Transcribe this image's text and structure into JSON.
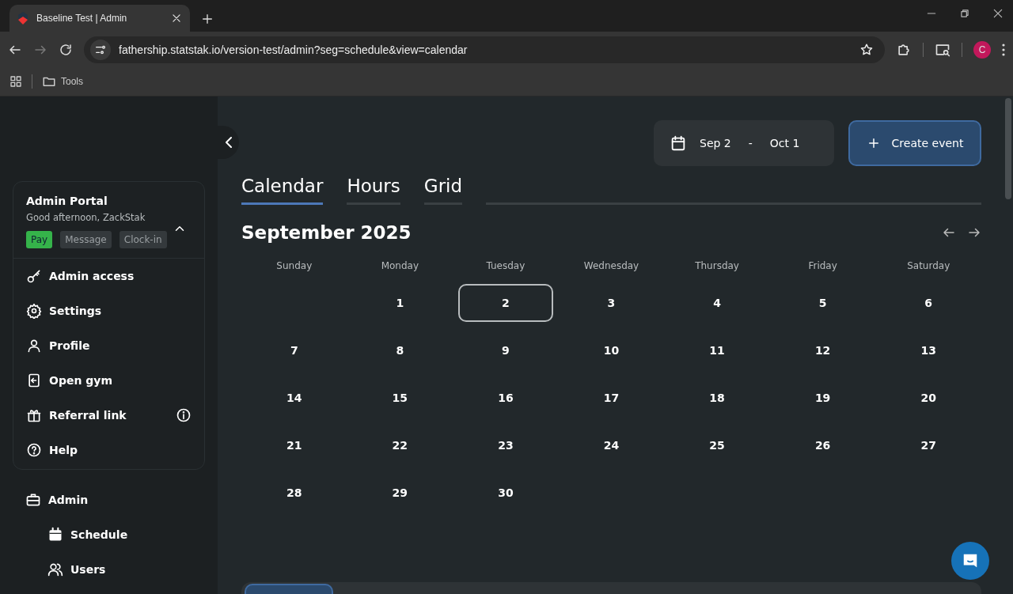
{
  "browser": {
    "tab_title": "Baseline Test | Admin",
    "url": "fathership.statstak.io/version-test/admin?seg=schedule&view=calendar",
    "bookmarks": [
      "Tools"
    ],
    "profile_initial": "C"
  },
  "sidebar": {
    "title": "Admin Portal",
    "greeting": "Good afternoon, ZackStak",
    "expanded": true,
    "actions": [
      {
        "label": "Pay",
        "kind": "primary"
      },
      {
        "label": "Message",
        "kind": "secondary"
      },
      {
        "label": "Clock-in",
        "kind": "secondary"
      }
    ],
    "menu": [
      {
        "label": "Admin access",
        "info": false
      },
      {
        "label": "Settings",
        "info": false
      },
      {
        "label": "Profile",
        "info": false
      },
      {
        "label": "Open gym",
        "info": false
      },
      {
        "label": "Referral link",
        "info": true
      },
      {
        "label": "Help",
        "info": false
      }
    ],
    "section": {
      "label": "Admin",
      "children": [
        {
          "label": "Schedule"
        },
        {
          "label": "Users"
        }
      ]
    }
  },
  "main": {
    "date_range": {
      "start": "Sep 2",
      "separator": "-",
      "end": "Oct 1"
    },
    "create_button": "Create event",
    "view_tabs": [
      {
        "label": "Calendar",
        "selected": true
      },
      {
        "label": "Hours",
        "selected": false
      },
      {
        "label": "Grid",
        "selected": false
      }
    ],
    "month_title": "September 2025",
    "weekdays": [
      "Sunday",
      "Monday",
      "Tuesday",
      "Wednesday",
      "Thursday",
      "Friday",
      "Saturday"
    ],
    "weeks": [
      [
        {
          "kind": "blank"
        },
        {
          "kind": "day",
          "label": "1",
          "selected": false
        },
        {
          "label": "2",
          "selected": true
        },
        {
          "label": "3",
          "selected": false
        },
        {
          "label": "4",
          "selected": false
        },
        {
          "label": "5",
          "selected": false
        },
        {
          "label": "6",
          "selected": false
        }
      ],
      [
        {
          "label": "7",
          "selected": false
        },
        {
          "label": "8",
          "selected": false
        },
        {
          "label": "9",
          "selected": false
        },
        {
          "label": "10",
          "selected": false
        },
        {
          "label": "11",
          "selected": false
        },
        {
          "label": "12",
          "selected": false
        },
        {
          "label": "13",
          "selected": false
        }
      ],
      [
        {
          "label": "14",
          "selected": false
        },
        {
          "label": "15",
          "selected": false
        },
        {
          "label": "16",
          "selected": false
        },
        {
          "label": "17",
          "selected": false
        },
        {
          "label": "18",
          "selected": false
        },
        {
          "label": "19",
          "selected": false
        },
        {
          "label": "20",
          "selected": false
        }
      ],
      [
        {
          "label": "21",
          "selected": false
        },
        {
          "label": "22",
          "selected": false
        },
        {
          "label": "23",
          "selected": false
        },
        {
          "label": "24",
          "selected": false
        },
        {
          "label": "25",
          "selected": false
        },
        {
          "label": "26",
          "selected": false
        },
        {
          "label": "27",
          "selected": false
        }
      ],
      [
        {
          "label": "28",
          "selected": false
        },
        {
          "label": "29",
          "selected": false
        },
        {
          "label": "30",
          "selected": false
        }
      ]
    ]
  }
}
